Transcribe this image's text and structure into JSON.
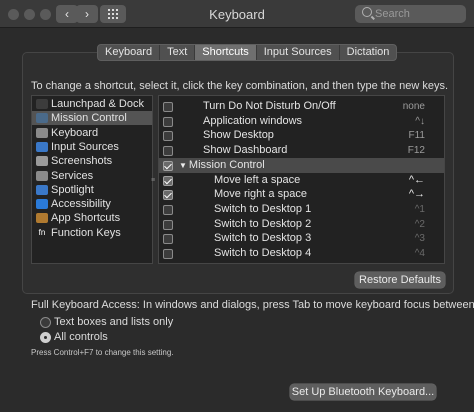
{
  "window": {
    "title": "Keyboard"
  },
  "search": {
    "placeholder": "Search"
  },
  "tabs": [
    {
      "label": "Keyboard",
      "active": false
    },
    {
      "label": "Text",
      "active": false
    },
    {
      "label": "Shortcuts",
      "active": true
    },
    {
      "label": "Input Sources",
      "active": false
    },
    {
      "label": "Dictation",
      "active": false
    }
  ],
  "instructions": "To change a shortcut, select it, click the key combination, and then type the new keys.",
  "categories": [
    {
      "label": "Launchpad & Dock",
      "icon": "launchpad-dock-icon",
      "color": "#3c3c3c",
      "selected": false
    },
    {
      "label": "Mission Control",
      "icon": "mission-control-icon",
      "color": "#4a6a8a",
      "selected": true
    },
    {
      "label": "Keyboard",
      "icon": "keyboard-icon",
      "color": "#8a8a8a",
      "selected": false
    },
    {
      "label": "Input Sources",
      "icon": "input-sources-icon",
      "color": "#3a78c8",
      "selected": false
    },
    {
      "label": "Screenshots",
      "icon": "screenshots-icon",
      "color": "#9a9a9a",
      "selected": false
    },
    {
      "label": "Services",
      "icon": "gear-icon",
      "color": "#8a8a8a",
      "selected": false
    },
    {
      "label": "Spotlight",
      "icon": "spotlight-icon",
      "color": "#3a78c8",
      "selected": false
    },
    {
      "label": "Accessibility",
      "icon": "accessibility-icon",
      "color": "#2a7ad8",
      "selected": false
    },
    {
      "label": "App Shortcuts",
      "icon": "app-shortcuts-icon",
      "color": "#b07a30",
      "selected": false
    },
    {
      "label": "Function Keys",
      "icon": "fn-key-icon",
      "color": "#3c3c3c",
      "selected": false
    }
  ],
  "shortcuts": [
    {
      "label": "Turn Do Not Disturb On/Off",
      "key": "none",
      "checked": false,
      "indent": 1,
      "header": false,
      "keystyle": ""
    },
    {
      "label": "Application windows",
      "key": "^↓",
      "checked": false,
      "indent": 1,
      "header": false,
      "keystyle": ""
    },
    {
      "label": "Show Desktop",
      "key": "F11",
      "checked": false,
      "indent": 1,
      "header": false,
      "keystyle": ""
    },
    {
      "label": "Show Dashboard",
      "key": "F12",
      "checked": false,
      "indent": 1,
      "header": false,
      "keystyle": ""
    },
    {
      "label": "Mission Control",
      "key": "",
      "checked": true,
      "indent": 0,
      "header": true,
      "keystyle": ""
    },
    {
      "label": "Move left a space",
      "key": "^←",
      "checked": true,
      "indent": 2,
      "header": false,
      "keystyle": "active"
    },
    {
      "label": "Move right a space",
      "key": "^→",
      "checked": true,
      "indent": 2,
      "header": false,
      "keystyle": "active"
    },
    {
      "label": "Switch to Desktop 1",
      "key": "^1",
      "checked": false,
      "indent": 2,
      "header": false,
      "keystyle": "dim"
    },
    {
      "label": "Switch to Desktop 2",
      "key": "^2",
      "checked": false,
      "indent": 2,
      "header": false,
      "keystyle": "dim"
    },
    {
      "label": "Switch to Desktop 3",
      "key": "^3",
      "checked": false,
      "indent": 2,
      "header": false,
      "keystyle": "dim"
    },
    {
      "label": "Switch to Desktop 4",
      "key": "^4",
      "checked": false,
      "indent": 2,
      "header": false,
      "keystyle": "dim"
    }
  ],
  "restore_button": "Restore Defaults",
  "full_keyboard_access": {
    "label": "Full Keyboard Access: In windows and dialogs, press Tab to move keyboard focus between:",
    "options": [
      {
        "label": "Text boxes and lists only",
        "selected": false
      },
      {
        "label": "All controls",
        "selected": true
      }
    ],
    "hint": "Press Control+F7 to change this setting."
  },
  "bluetooth_button": "Set Up Bluetooth Keyboard..."
}
